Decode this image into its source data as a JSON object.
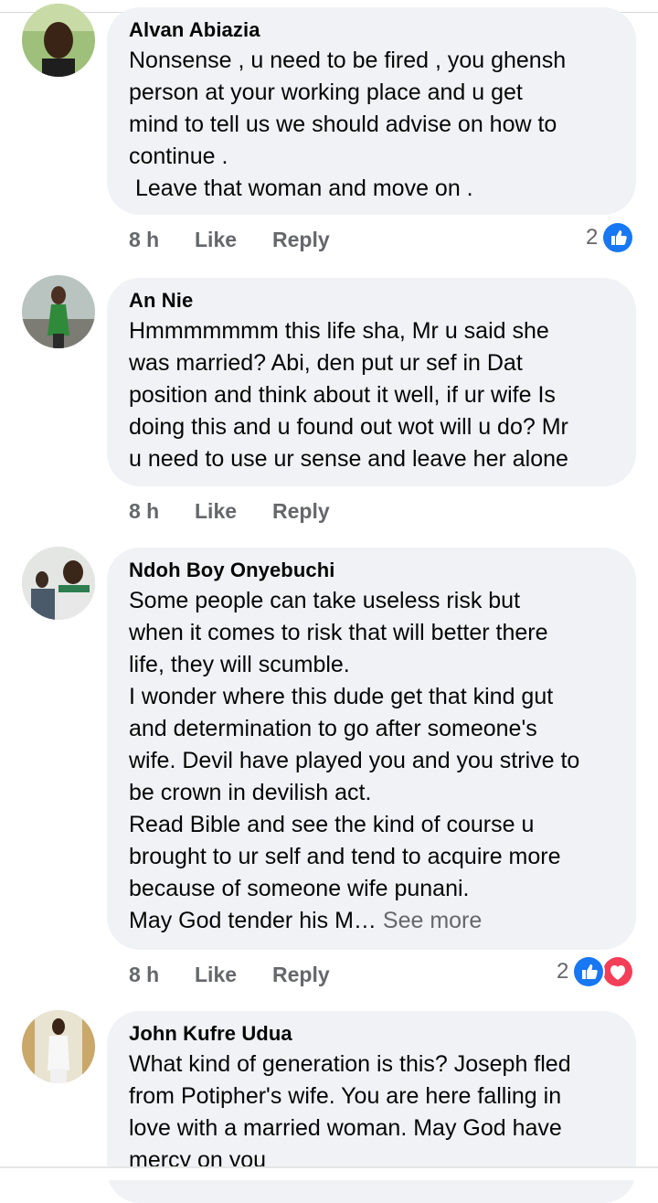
{
  "comments": [
    {
      "author": "Alvan Abiazia",
      "text": "Nonsense , u need to be fired , you ghensh\nperson at your working place and u get\nmind to tell us we should advise on how to\ncontinue .\n Leave that woman and move on .",
      "time": "8 h",
      "like_label": "Like",
      "reply_label": "Reply",
      "reaction_count": "2",
      "reactions": [
        "like-icon"
      ]
    },
    {
      "author": "An Nie",
      "text": "Hmmmmmmm this life sha, Mr u said she\nwas married? Abi, den put ur sef in Dat\nposition and think about it well, if ur wife Is\ndoing this and u found out wot will u do? Mr\nu need to use ur sense and leave her alone",
      "time": "8 h",
      "like_label": "Like",
      "reply_label": "Reply"
    },
    {
      "author": "Ndoh Boy Onyebuchi",
      "text": "Some people can take useless risk but\nwhen it comes to risk that will better there\nlife, they will scumble.\nI wonder where this dude get that kind gut\nand determination to go after someone's\nwife. Devil have played you and you strive to\nbe crown in devilish act.\nRead Bible and see the kind of course u\nbrought to ur self and tend to acquire more\nbecause of someone wife punani.\nMay God tender his M… ",
      "see_more": "See more",
      "time": "8 h",
      "like_label": "Like",
      "reply_label": "Reply",
      "reaction_count": "2",
      "reactions": [
        "like-icon",
        "love-icon"
      ]
    },
    {
      "author": "John Kufre Udua",
      "text": "What kind of generation is this? Joseph fled\nfrom Potipher's wife. You are here falling in\nlove with a married woman. May God have\nmercy on you"
    }
  ],
  "colors": {
    "bubble": "#f0f2f5",
    "meta_text": "#65676b",
    "like_blue": "#1877f2",
    "love_red": "#f33e58"
  }
}
